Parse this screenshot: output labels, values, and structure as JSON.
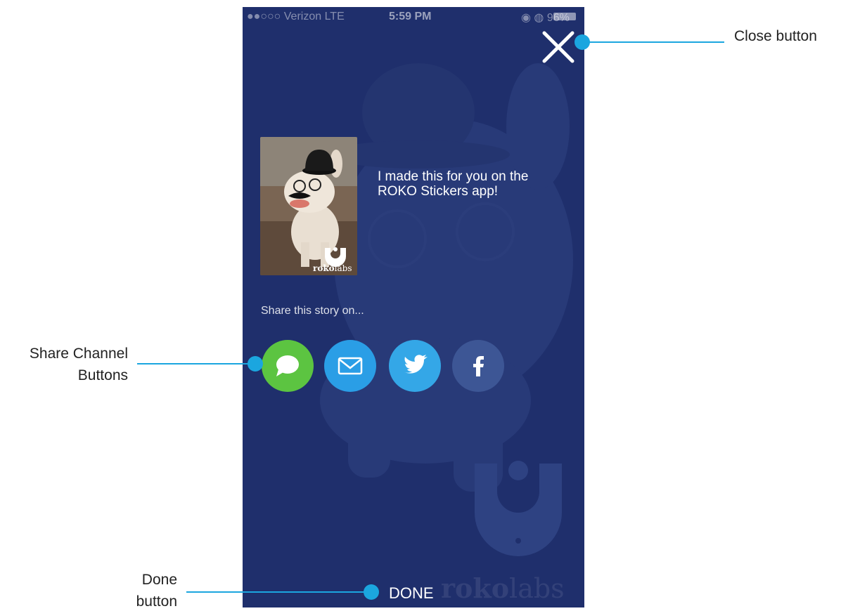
{
  "status_bar": {
    "carrier": "●●○○○ Verizon  LTE",
    "time": "5:59 PM",
    "battery": "◉ ◍ 96%"
  },
  "share_card": {
    "message": "I made this for you on the ROKO Stickers app!",
    "share_prompt": "Share this story on...",
    "thumbnail_brand_bold": "roko",
    "thumbnail_brand_light": "labs"
  },
  "share_channels": [
    {
      "name": "message",
      "icon": "speech-bubble-icon",
      "color": "#5cc441"
    },
    {
      "name": "email",
      "icon": "envelope-icon",
      "color": "#2a9ee6"
    },
    {
      "name": "twitter",
      "icon": "twitter-bird-icon",
      "color": "#34a7e7"
    },
    {
      "name": "facebook",
      "icon": "facebook-f-icon",
      "color": "#3d5695"
    }
  ],
  "done_label": "DONE",
  "watermark": {
    "bold": "roko",
    "light": "labs"
  },
  "annotations": {
    "close": "Close button",
    "share_line1": "Share Channel",
    "share_line2": "Buttons",
    "done_line1": "Done",
    "done_line2": "button"
  },
  "colors": {
    "background": "#1f2f6c",
    "annotation": "#1ba6df"
  }
}
